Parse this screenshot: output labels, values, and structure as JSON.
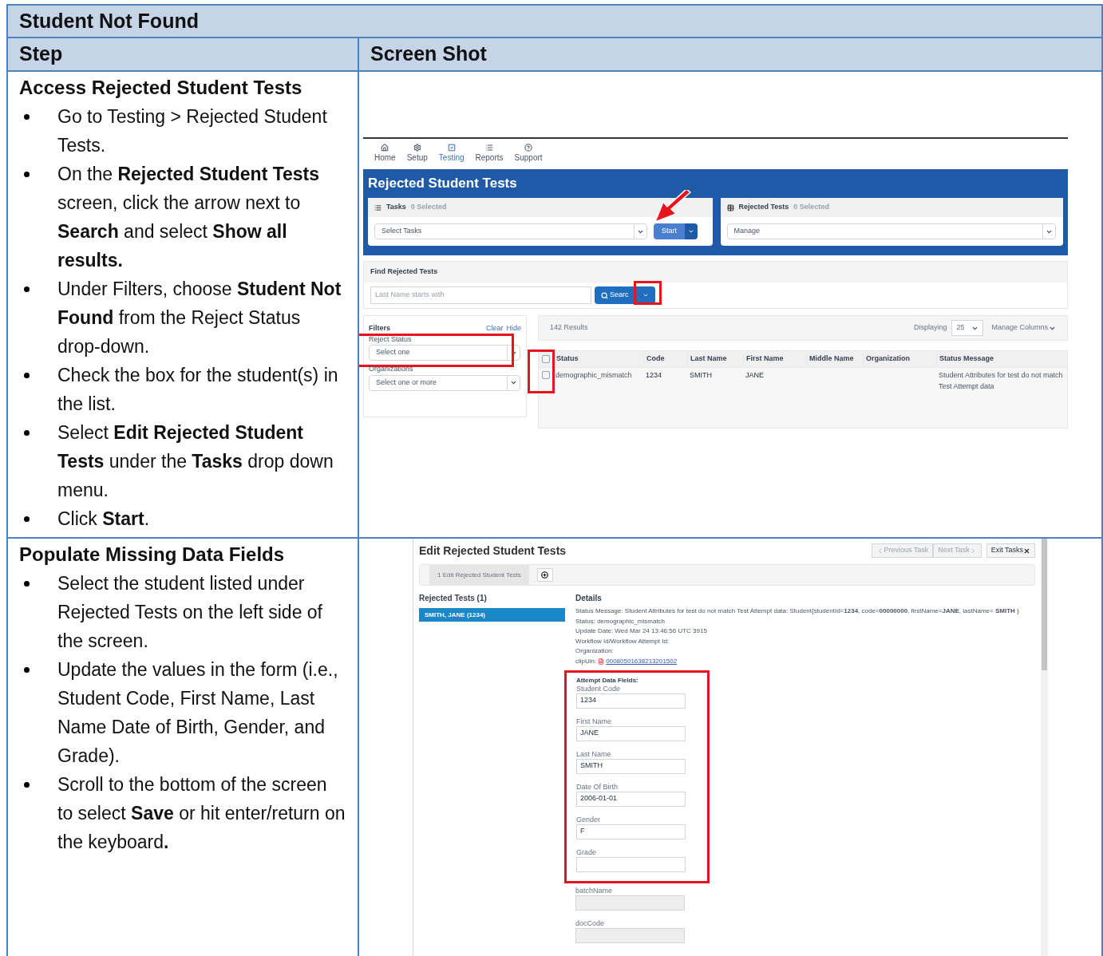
{
  "title": "Student Not Found",
  "columns": [
    "Step",
    "Screen Shot"
  ],
  "rows": [
    {
      "heading": "Access Rejected Student Tests",
      "bullets": [
        "Go to Testing > Rejected Student Tests.",
        "On the **Rejected Student Tests** screen, click the arrow next to **Search** and select **Show all results.**",
        "Under Filters, choose **Student Not Found** from the Reject Status drop-down.",
        "Check the box for the student(s) in the list.",
        "Select **Edit Rejected Student Tests** under the **Tasks** drop down menu.",
        "Click **Start**."
      ],
      "shot": {
        "kind": "rejected_list",
        "nav": [
          {
            "label": "Home",
            "selected": false
          },
          {
            "label": "Setup",
            "selected": false
          },
          {
            "label": "Testing",
            "selected": true
          },
          {
            "label": "Reports",
            "selected": false
          },
          {
            "label": "Support",
            "selected": false
          }
        ],
        "page_title": "Rejected Student Tests",
        "panels": [
          {
            "title": "Tasks",
            "count": "0 Selected",
            "select": "Select Tasks",
            "button": "Start"
          },
          {
            "title": "Rejected Tests",
            "count": "0 Selected",
            "select": "Manage"
          }
        ],
        "find": {
          "title": "Find Rejected Tests",
          "placeholder": "Last Name starts with",
          "button": "Searc"
        },
        "filters": {
          "title": "Filters",
          "links": [
            "Clear",
            "Hide"
          ],
          "fields": [
            {
              "label": "Reject Status",
              "placeholder": "Select one"
            },
            {
              "label": "Organizations",
              "placeholder": "Select one or more"
            }
          ]
        },
        "results": {
          "count": "142 Results",
          "displaying": "Displaying",
          "page_size": "25",
          "manage": "Manage Columns",
          "header_checked": false,
          "columns": [
            "Status",
            "Code",
            "Last Name",
            "First Name",
            "Middle Name",
            "Organization",
            "Status Message"
          ],
          "rows": [
            {
              "checked": false,
              "status": "demographic_mismatch",
              "code": "1234",
              "last_name": "SMITH",
              "first_name": "JANE",
              "status_message": "Student Attributes for test do not match Test Attempt data"
            }
          ]
        }
      }
    },
    {
      "heading": "Populate Missing Data Fields",
      "bullets": [
        "Select the student listed under Rejected Tests on the left side of the screen.",
        "Update the values in the form (i.e., Student Code, First Name, Last Name Date of Birth, Gender, and Grade).",
        "Scroll to the bottom of the screen to select **Save** or hit enter/return on the keyboard**.**"
      ],
      "shot": {
        "kind": "edit_form",
        "page_title": "Edit Rejected Student Tests",
        "buttons": [
          {
            "label": "Previous Task",
            "kind": "prev",
            "disabled": true
          },
          {
            "label": "Next Task",
            "kind": "next",
            "disabled": true
          },
          {
            "label": "Exit Tasks",
            "kind": "exit",
            "disabled": false
          }
        ],
        "tab": "1 Edit Rejected Student Tests",
        "list_title": "Rejected Tests (1)",
        "list": [
          {
            "label": "SMITH, JANE (1234)",
            "selected": true
          }
        ],
        "details_title": "Details",
        "details": [
          "Status Message: Student Attributes for test do not match Test Attempt data: Student{studentId=**1234**, code=**00000000**, firstName=**JANE**, lastName= **SMITH** }",
          "Status: demographic_mismatch",
          "Update Date: Wed Mar 24 13:46:56 UTC 3915",
          "Workflow Id/Workflow Attempt Id:",
          "Organization:"
        ],
        "clip": {
          "label": "clipUin:",
          "link": "00080501638213201502"
        },
        "form_title": "Attempt Data Fields:",
        "highlighted_fields": [
          {
            "label": "Student Code",
            "value": "1234",
            "disabled": false
          },
          {
            "label": "First Name",
            "value": "JANE",
            "disabled": false
          },
          {
            "label": "Last Name",
            "value": "SMITH",
            "disabled": false
          },
          {
            "label": "Date Of Birth",
            "value": "2006-01-01",
            "disabled": false
          },
          {
            "label": "Gender",
            "value": "F",
            "disabled": false
          },
          {
            "label": "Grade",
            "disabled": false
          }
        ],
        "other_fields": [
          {
            "label": "batchName",
            "disabled": true
          },
          {
            "label": "docCode",
            "disabled": true
          }
        ]
      }
    }
  ]
}
